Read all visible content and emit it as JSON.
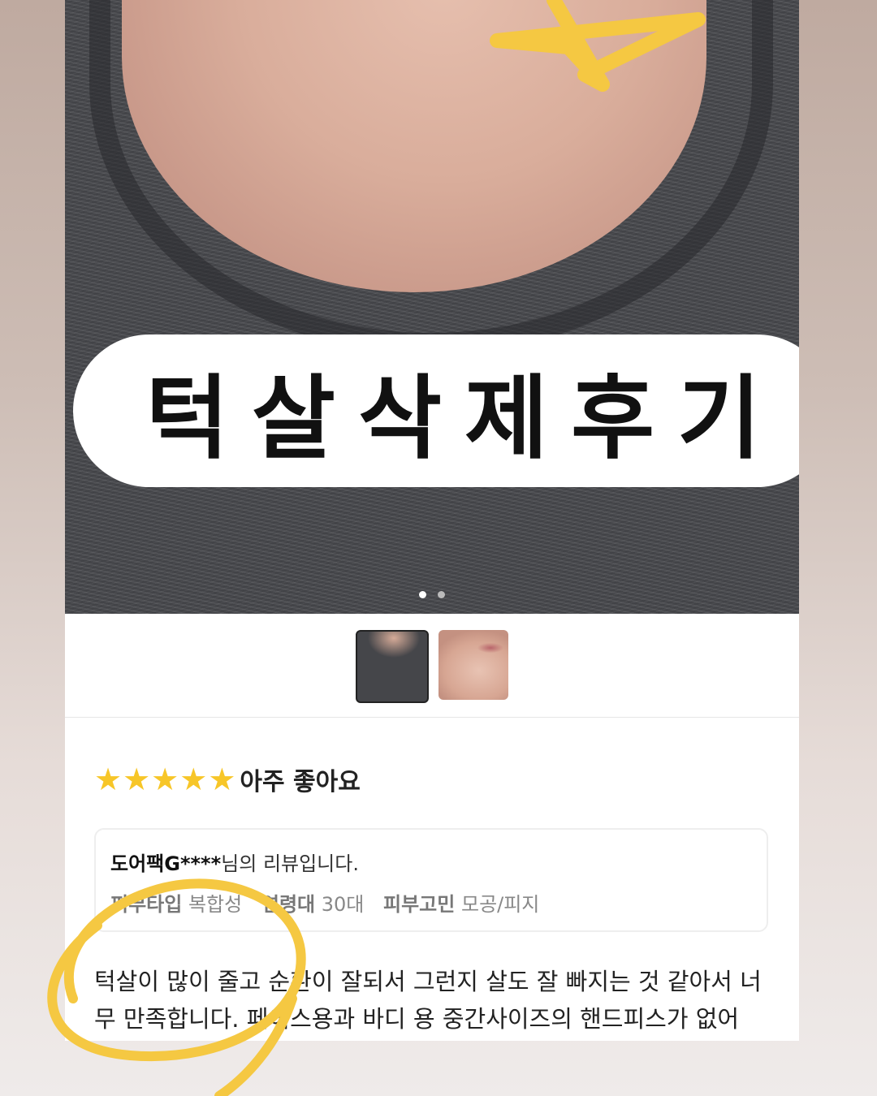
{
  "title": "턱살삭제후기",
  "gallery": {
    "dot_count": 2,
    "active_dot": 0,
    "thumbnails": [
      "neck-photo-thumbnail",
      "jaw-photo-thumbnail"
    ]
  },
  "rating": {
    "stars": 5,
    "max_stars": 5,
    "label": "아주 좋아요",
    "star_color": "#f7c628"
  },
  "review": {
    "reviewer_name": "도어팩G****",
    "reviewer_suffix": "님의 리뷰입니다.",
    "skin_type_label": "피부타입",
    "skin_type_value": "복합성",
    "age_label": "연령대",
    "age_value": "30대",
    "concern_label": "피부고민",
    "concern_value": "모공/피지",
    "body": "턱살이 많이 줄고 순환이 잘되서 그런지 살도 잘 빠지는 것 같아서 너무 만족합니다. 페이스용과 바디 용 중간사이즈의 핸드피스가 없어"
  },
  "colors": {
    "annotation_yellow": "#f5c842"
  }
}
